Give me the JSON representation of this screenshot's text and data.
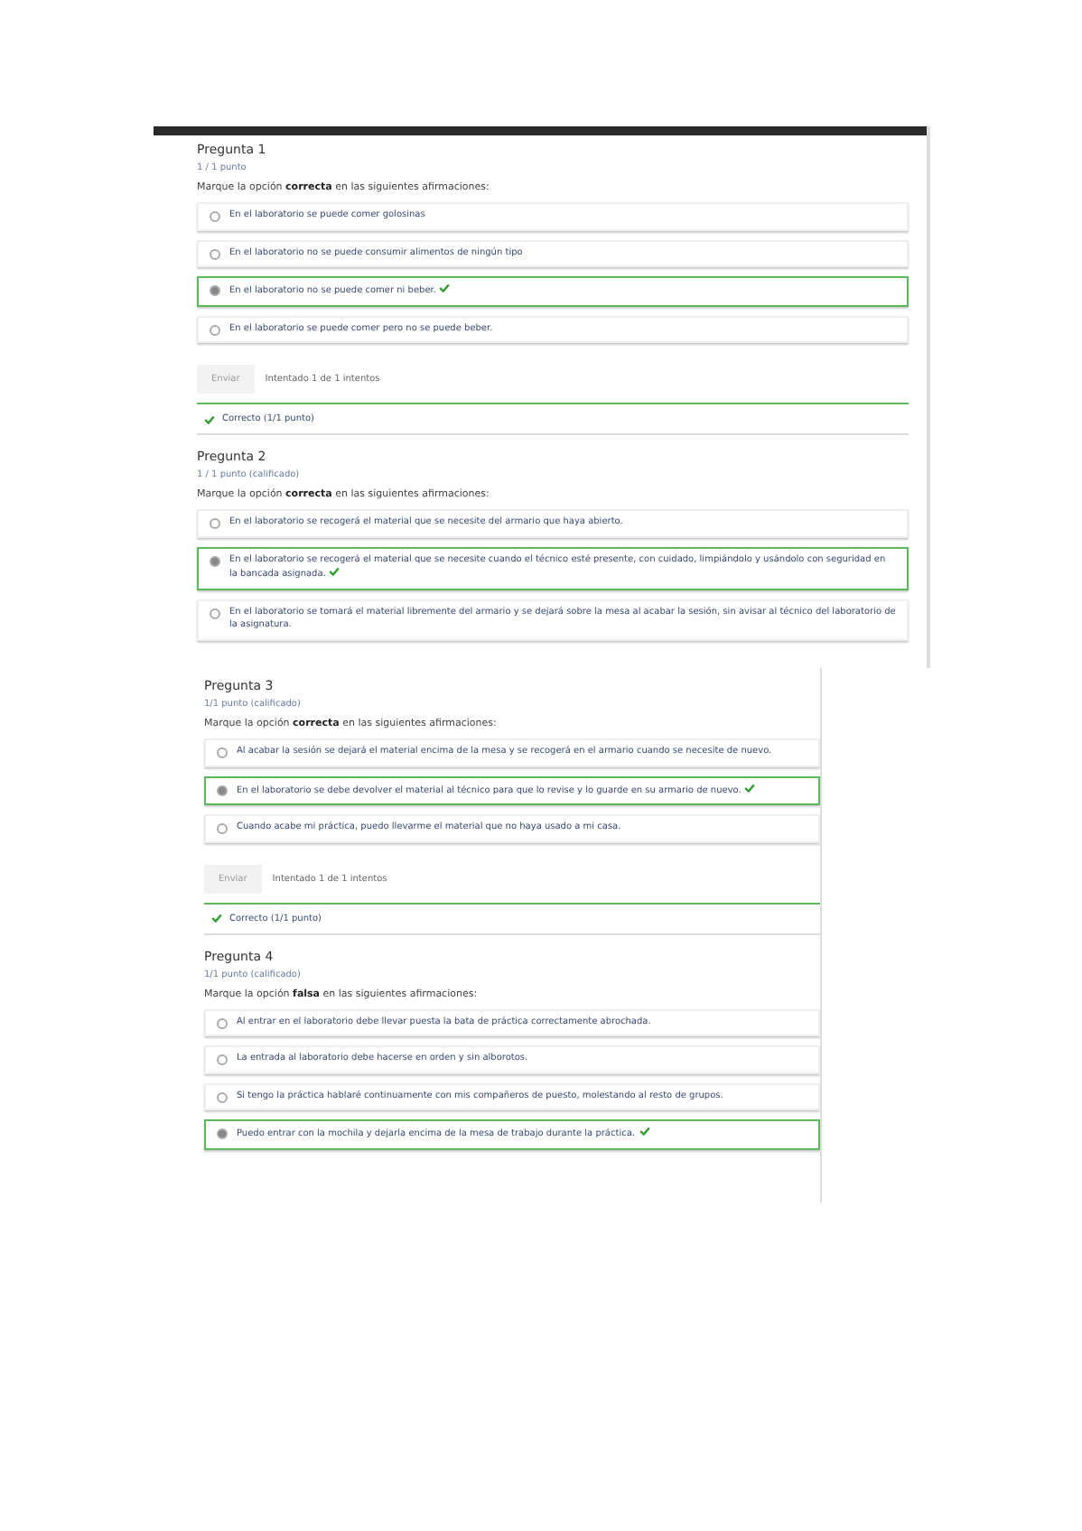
{
  "panels": [
    {
      "top_bar": true,
      "questions": [
        {
          "title": "Pregunta 1",
          "points": "1 / 1 punto",
          "prompt": "Marque la opción **correcta** en las siguientes afirmaciones:",
          "options": [
            {
              "text": "En el laboratorio se puede comer golosinas",
              "selected": false
            },
            {
              "text": "En el laboratorio no se puede consumir alimentos de ningún tipo",
              "selected": false
            },
            {
              "text": "En el laboratorio no se puede comer ni beber.",
              "selected": true
            },
            {
              "text": "En el laboratorio se puede comer pero no se puede beber.",
              "selected": false
            }
          ],
          "submit": {
            "label": "Enviar",
            "attempts": "Intentado 1 de 1 intentos"
          },
          "feedback": "Correcto (1/1 punto)"
        },
        {
          "title": "Pregunta 2",
          "points": "1 / 1 punto (calificado)",
          "prompt": "Marque la opción **correcta** en las siguientes afirmaciones:",
          "options": [
            {
              "text": "En el laboratorio se recogerá el material que se necesite del armario que haya abierto.",
              "selected": false
            },
            {
              "text": "En el laboratorio se recogerá el material que se necesite cuando el técnico esté presente, con cuidado, limpiándolo y usándolo con seguridad en la bancada asignada.",
              "selected": true
            },
            {
              "text": "En el laboratorio se tomará el material libremente del armario y se dejará sobre la mesa al acabar la sesión, sin avisar al técnico del laboratorio de la asignatura.",
              "selected": false
            }
          ]
        }
      ]
    },
    {
      "top_bar": false,
      "questions": [
        {
          "title": "Pregunta 3",
          "points": "1/1 punto (calificado)",
          "prompt": "Marque la opción **correcta** en las siguientes afirmaciones:",
          "options": [
            {
              "text": "Al acabar la sesión se dejará el material encima de la mesa y se recogerá en el armario cuando se necesite de nuevo.",
              "selected": false
            },
            {
              "text": "En el laboratorio se debe devolver el material al técnico para que lo revise y lo guarde en su armario de nuevo.",
              "selected": true
            },
            {
              "text": "Cuando acabe mi práctica, puedo llevarme el material que no haya usado a mi casa.",
              "selected": false
            }
          ],
          "submit": {
            "label": "Enviar",
            "attempts": "Intentado 1 de 1 intentos"
          },
          "feedback": "Correcto (1/1 punto)"
        },
        {
          "title": "Pregunta 4",
          "points": "1/1 punto (calificado)",
          "prompt": "Marque la opción **falsa** en las siguientes afirmaciones:",
          "options": [
            {
              "text": "Al entrar en el laboratorio debe llevar puesta la bata de práctica correctamente abrochada.",
              "selected": false
            },
            {
              "text": "La entrada al laboratorio debe hacerse en orden y sin alborotos.",
              "selected": false
            },
            {
              "text": "Si tengo la práctica hablaré continuamente con mis compañeros de puesto, molestando al resto de grupos.",
              "selected": false
            },
            {
              "text": "Puedo entrar con la mochila y dejarla encima de la mesa de trabajo durante la práctica.",
              "selected": true
            }
          ]
        }
      ]
    }
  ]
}
